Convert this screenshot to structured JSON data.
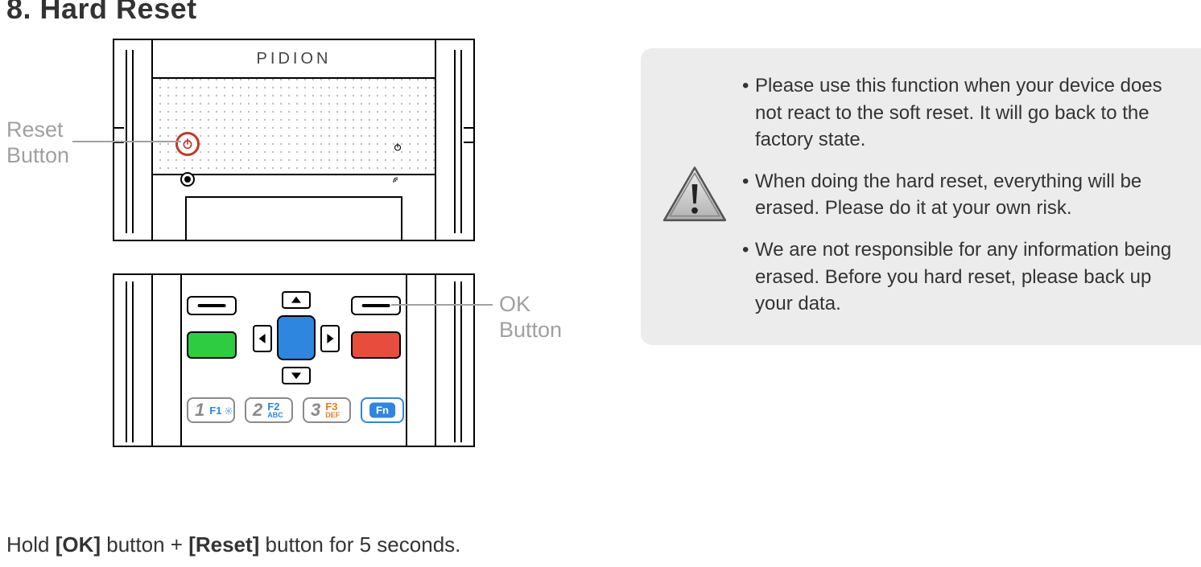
{
  "title": "8. Hard Reset",
  "device": {
    "brand": "PIDION"
  },
  "callouts": {
    "reset_line1": "Reset",
    "reset_line2": "Button",
    "ok_line1": "OK",
    "ok_line2": "Button"
  },
  "keypad": {
    "key1_digit": "1",
    "key1_f": "F1",
    "key1_sub": "",
    "key2_digit": "2",
    "key2_f": "F2",
    "key2_sub": "ABC",
    "key3_digit": "3",
    "key3_f": "F3",
    "key3_sub": "DEF",
    "fn": "Fn"
  },
  "instruction": {
    "pre": "Hold ",
    "ok": "[OK]",
    "mid": " button + ",
    "reset": "[Reset]",
    "post": " button for 5 seconds."
  },
  "warning": {
    "b1": "Please use this function when your device does not react to the soft reset. It will go back to the factory state.",
    "b2": "When doing the hard reset, everything will be erased. Please do it at your own risk.",
    "b3": "We are not responsible for any information being erased. Before you hard reset, please back up your data."
  }
}
